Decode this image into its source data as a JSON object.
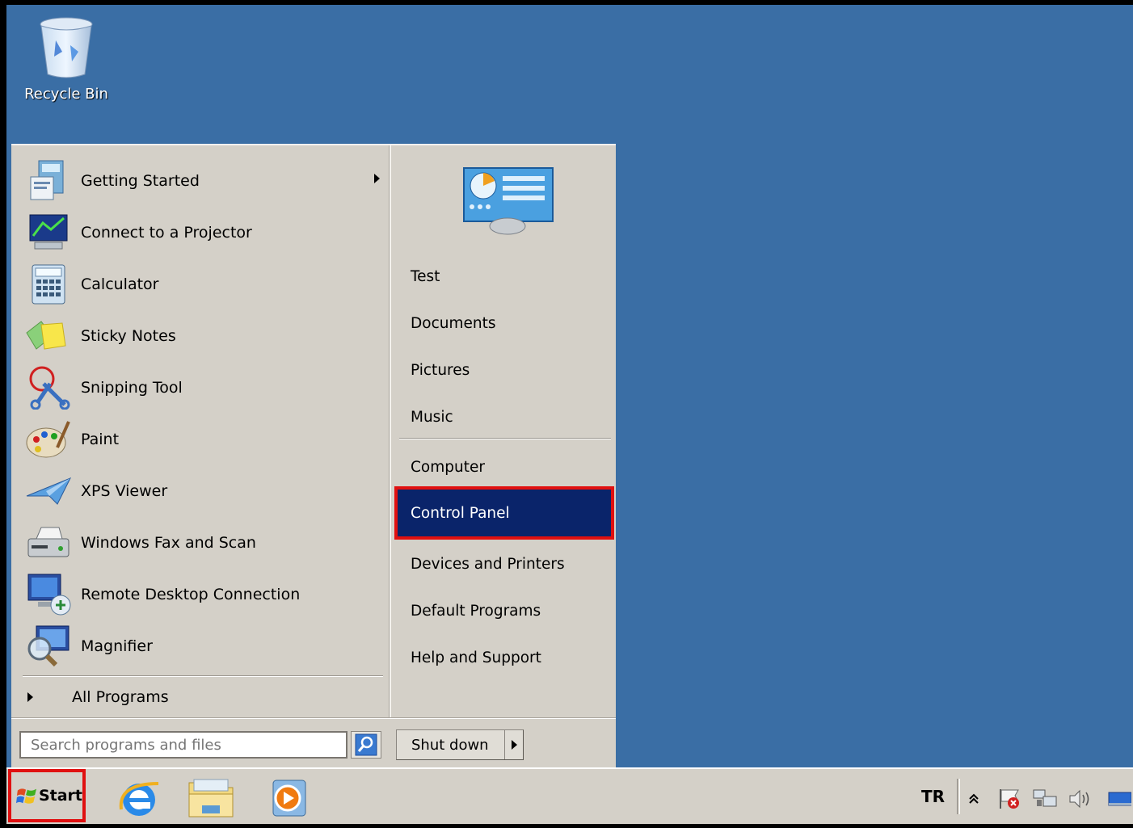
{
  "desktop": {
    "recycle_bin_label": "Recycle Bin"
  },
  "start_menu": {
    "programs": [
      {
        "label": "Getting Started",
        "icon": "getting-started-icon",
        "has_submenu": true
      },
      {
        "label": "Connect to a Projector",
        "icon": "projector-icon"
      },
      {
        "label": "Calculator",
        "icon": "calculator-icon"
      },
      {
        "label": "Sticky Notes",
        "icon": "sticky-notes-icon"
      },
      {
        "label": "Snipping Tool",
        "icon": "snipping-tool-icon"
      },
      {
        "label": "Paint",
        "icon": "paint-palette-icon"
      },
      {
        "label": "XPS Viewer",
        "icon": "xps-viewer-icon"
      },
      {
        "label": "Windows Fax and Scan",
        "icon": "fax-scanner-icon"
      },
      {
        "label": "Remote Desktop Connection",
        "icon": "remote-desktop-icon"
      },
      {
        "label": "Magnifier",
        "icon": "magnifier-icon"
      }
    ],
    "all_programs_label": "All Programs",
    "right_links": {
      "user": "Test",
      "documents": "Documents",
      "pictures": "Pictures",
      "music": "Music",
      "computer": "Computer",
      "control_panel": "Control Panel",
      "devices": "Devices and Printers",
      "default_programs": "Default Programs",
      "help": "Help and Support"
    },
    "search_placeholder": "Search programs and files",
    "shutdown_label": "Shut down"
  },
  "taskbar": {
    "start_label": "Start",
    "language": "TR",
    "pinned": [
      "internet-explorer-icon",
      "file-explorer-icon",
      "media-player-icon"
    ],
    "tray_icons": [
      "show-hidden-icons-chevron-icon",
      "action-center-flag-icon",
      "network-icon",
      "volume-icon",
      "show-desktop-icon"
    ]
  },
  "colors": {
    "desktop": "#3a6ea5",
    "menu_bg": "#d4d0c8",
    "highlight": "#0a246a",
    "annotation_red": "#e01010"
  }
}
